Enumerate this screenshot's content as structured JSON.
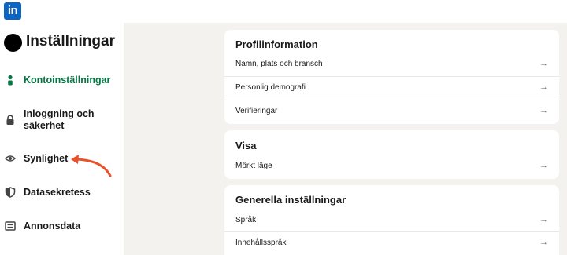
{
  "header": {
    "logo_text": "in"
  },
  "sidebar": {
    "title": "Inställningar",
    "items": [
      {
        "label": "Kontoinställningar",
        "icon": "person-icon",
        "active": true
      },
      {
        "label": "Inloggning och säkerhet",
        "icon": "lock-icon",
        "active": false
      },
      {
        "label": "Synlighet",
        "icon": "eye-icon",
        "active": false
      },
      {
        "label": "Datasekretess",
        "icon": "shield-icon",
        "active": false
      },
      {
        "label": "Annonsdata",
        "icon": "newspaper-icon",
        "active": false
      }
    ]
  },
  "main": {
    "sections": [
      {
        "title": "Profilinformation",
        "rows": [
          "Namn, plats och bransch",
          "Personlig demografi",
          "Verifieringar"
        ]
      },
      {
        "title": "Visa",
        "rows": [
          "Mörkt läge"
        ]
      },
      {
        "title": "Generella inställningar",
        "rows": [
          "Språk",
          "Innehållsspråk"
        ]
      }
    ],
    "row_arrow": "→"
  },
  "colors": {
    "brand": "#0a66c2",
    "active": "#057642",
    "annotation": "#e8512a",
    "background": "#f4f2ee"
  }
}
